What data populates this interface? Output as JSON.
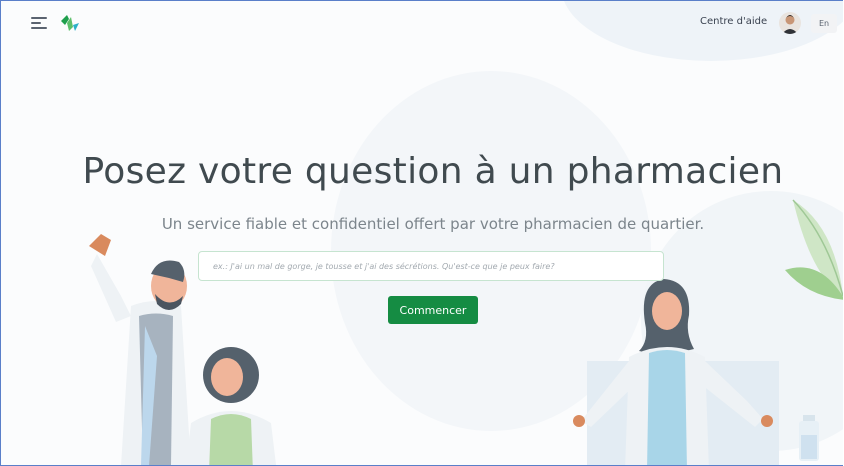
{
  "header": {
    "menu_icon": "hamburger-icon",
    "logo_icon": "pharmacy-cross-logo-icon",
    "help_link": "Centre d'aide",
    "avatar_icon": "user-avatar-icon",
    "language_button": "En"
  },
  "hero": {
    "title": "Posez votre question à un pharmacien",
    "subtitle": "Un service fiable et confidentiel offert par votre pharmacien de quartier.",
    "search_placeholder": "ex.: J'ai un mal de gorge, je tousse et j'ai des sécrétions. Qu'est-ce que je peux faire?",
    "search_value": "",
    "cta_label": "Commencer"
  },
  "colors": {
    "primary": "#158c43",
    "heading": "#404a4f",
    "subtext": "#7c858c",
    "input_border": "#c6e4d0"
  }
}
